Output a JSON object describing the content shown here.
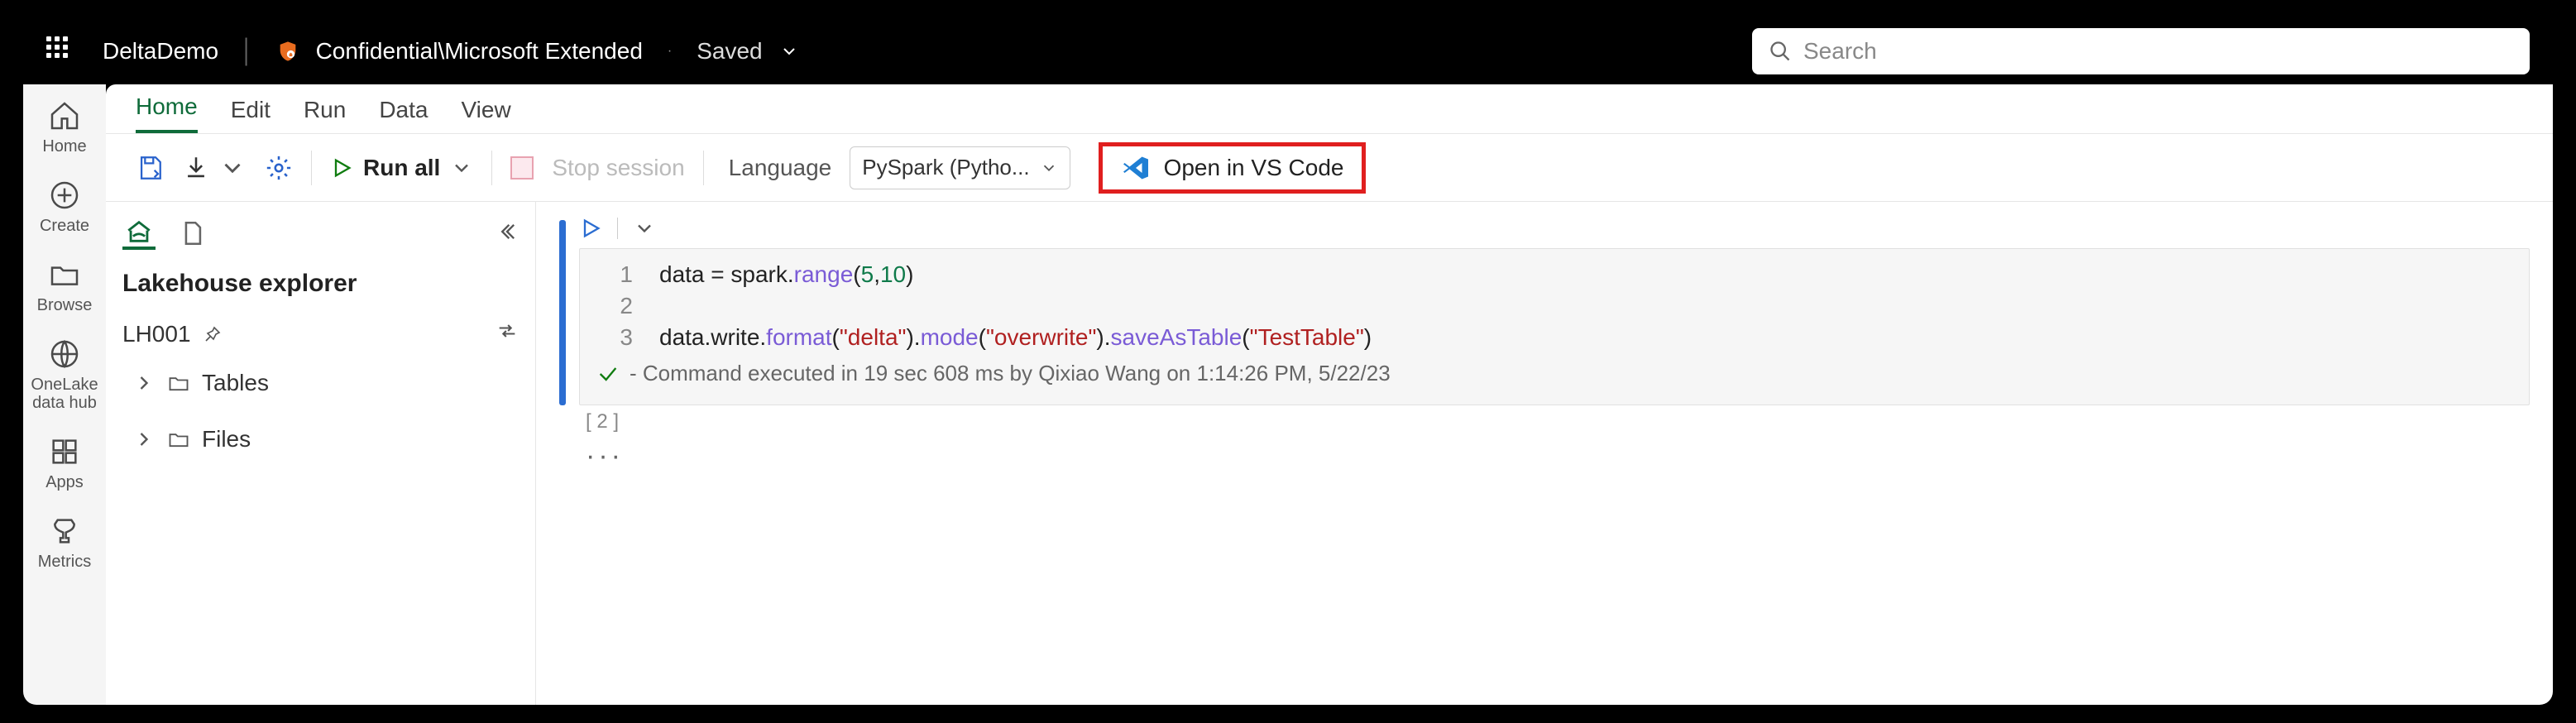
{
  "topbar": {
    "workspace": "DeltaDemo",
    "confidential": "Confidential\\Microsoft Extended",
    "saved": "Saved",
    "search_placeholder": "Search"
  },
  "rail": {
    "home": "Home",
    "create": "Create",
    "browse": "Browse",
    "onelake": "OneLake data hub",
    "apps": "Apps",
    "metrics": "Metrics"
  },
  "tabs": {
    "home": "Home",
    "edit": "Edit",
    "run": "Run",
    "data": "Data",
    "view": "View"
  },
  "toolbar": {
    "run_all": "Run all",
    "stop": "Stop session",
    "language_label": "Language",
    "language_value": "PySpark (Pytho...",
    "open_vscode": "Open in VS Code"
  },
  "explorer": {
    "title": "Lakehouse explorer",
    "lh_name": "LH001",
    "tables": "Tables",
    "files": "Files"
  },
  "cell": {
    "index": "[ 2 ]",
    "line1_pre": "data = spark.",
    "line1_fn": "range",
    "line1_open": "(",
    "line1_a": "5",
    "line1_comma": ",",
    "line1_b": "10",
    "line1_close": ")",
    "line3_pre": "data.write.",
    "line3_fn1": "format",
    "line3_open1": "(",
    "line3_s1": "\"delta\"",
    "line3_close1": ").",
    "line3_fn2": "mode",
    "line3_open2": "(",
    "line3_s2": "\"overwrite\"",
    "line3_close2": ").",
    "line3_fn3": "saveAsTable",
    "line3_open3": "(",
    "line3_s3": "\"TestTable\"",
    "line3_close3": ")",
    "status": "- Command executed in 19 sec 608 ms by Qixiao Wang on 1:14:26 PM, 5/22/23"
  }
}
